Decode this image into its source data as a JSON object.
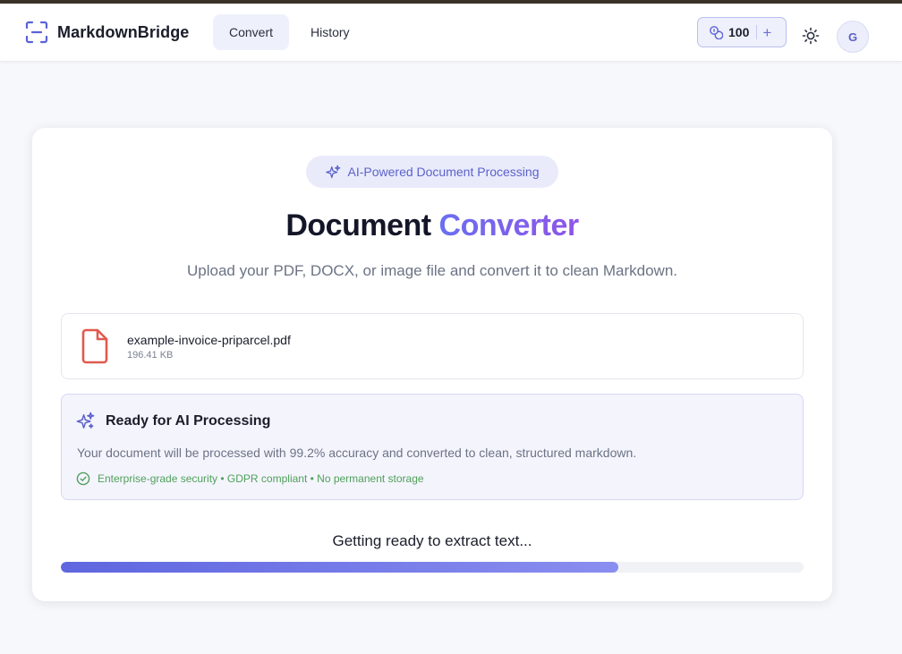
{
  "app": {
    "name": "MarkdownBridge"
  },
  "nav": {
    "tabs": [
      {
        "label": "Convert",
        "active": true
      },
      {
        "label": "History",
        "active": false
      }
    ]
  },
  "credits": {
    "count": "100",
    "add_symbol": "+"
  },
  "user": {
    "initial": "G"
  },
  "icons": {
    "brand": "scan-bracket-icon",
    "credits": "coins-icon",
    "theme": "sun-icon",
    "pill": "sparkles-icon",
    "file": "pdf-file-icon",
    "ready": "sparkles-icon",
    "security": "check-circle-icon"
  },
  "colors": {
    "accent": "#6a6ff0",
    "accent_end": "#8e55e8",
    "file_icon": "#e05a4e",
    "success": "#4fa05a"
  },
  "main": {
    "badge": "AI-Powered Document Processing",
    "title_main": "Document",
    "title_accent": "Converter",
    "subtitle": "Upload your PDF, DOCX, or image file and convert it to clean Markdown.",
    "file": {
      "name": "example-invoice-priparcel.pdf",
      "size": "196.41 KB"
    },
    "ready": {
      "title": "Ready for AI Processing",
      "description": "Your document will be processed with 99.2% accuracy and converted to clean, structured markdown.",
      "security": "Enterprise-grade security • GDPR compliant • No permanent storage"
    },
    "status": "Getting ready to extract text...",
    "progress_percent": 75
  }
}
